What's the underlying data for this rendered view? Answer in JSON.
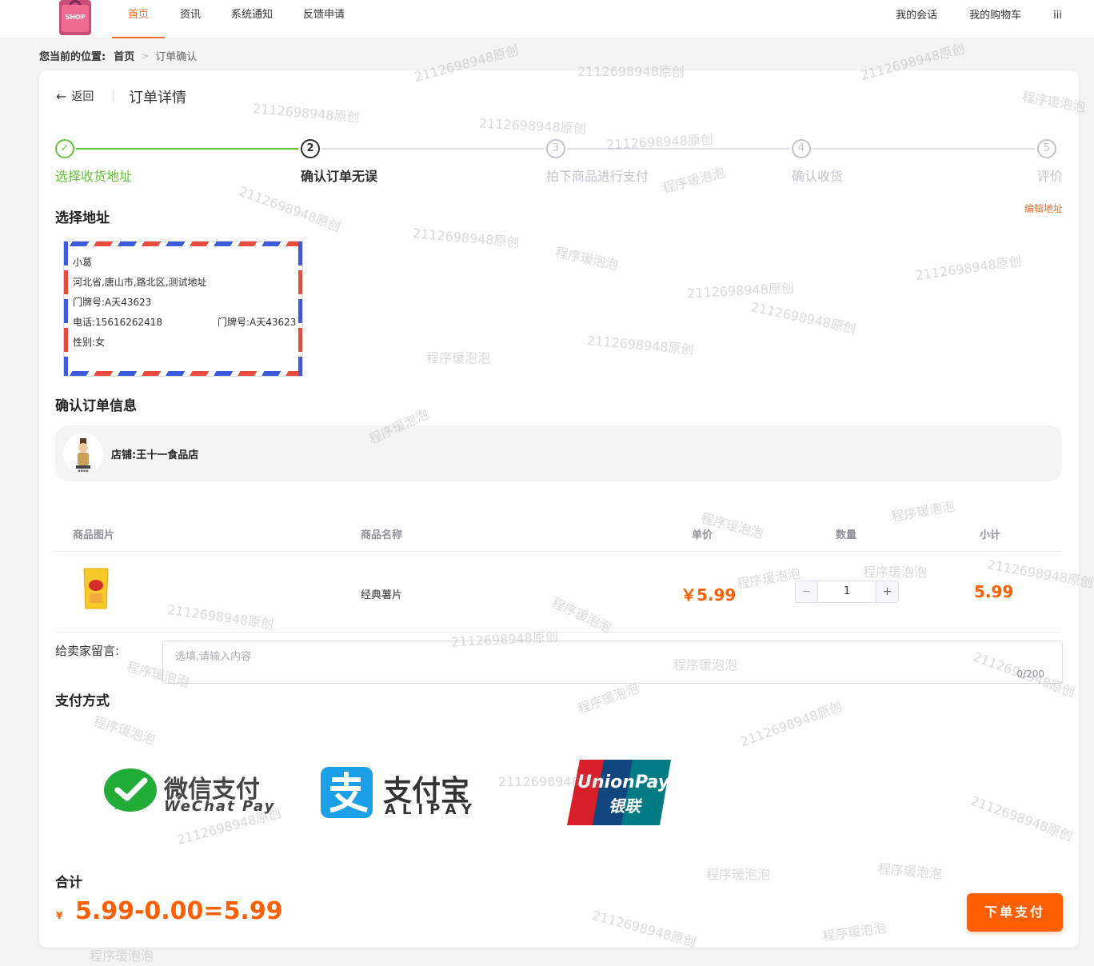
{
  "header": {
    "logo_text": "SHOP",
    "nav": [
      "首页",
      "资讯",
      "系统通知",
      "反馈申请"
    ],
    "right_nav": [
      "我的会话",
      "我的购物车",
      "iii"
    ]
  },
  "breadcrumb": {
    "prefix": "您当前的位置:",
    "home": "首页",
    "separator": ">",
    "current": "订单确认"
  },
  "page": {
    "back_label": "返回",
    "title": "订单详情"
  },
  "steps": [
    {
      "index": "1",
      "label": "选择收货地址",
      "status": "done"
    },
    {
      "index": "2",
      "label": "确认订单无误",
      "status": "current"
    },
    {
      "index": "3",
      "label": "拍下商品进行支付",
      "status": "wait"
    },
    {
      "index": "4",
      "label": "确认收货",
      "status": "wait"
    },
    {
      "index": "5",
      "label": "评价",
      "status": "wait"
    }
  ],
  "address": {
    "section_title": "选择地址",
    "edit_label": "编辑地址",
    "name": "小葛",
    "region": "河北省,唐山市,路北区,测试地址",
    "door": "门牌号:A天43623",
    "phone": "电话:15616262418",
    "door2": "门牌号:A天43623",
    "gender": "性别:女"
  },
  "order": {
    "section_title": "确认订单信息",
    "shop_name": "店铺:王十一食品店",
    "columns": [
      "商品图片",
      "商品名称",
      "单价",
      "数量",
      "小计"
    ],
    "item": {
      "name": "经典薯片",
      "price": "￥5.99",
      "quantity": "1",
      "subtotal": "5.99"
    },
    "stepper_minus": "−",
    "stepper_plus": "+"
  },
  "message": {
    "label": "给卖家留言:",
    "placeholder": "选填,请输入内容",
    "counter": "0/200"
  },
  "payment": {
    "section_title": "支付方式",
    "wechat_cn": "微信支付",
    "wechat_en": "WeChat Pay",
    "alipay_cn": "支付宝",
    "alipay_en": "ALIPAY",
    "union_en": "UnionPay",
    "union_cn": "银联"
  },
  "total": {
    "label": "合计",
    "currency": "¥",
    "expression": "5.99-0.00=5.99"
  },
  "submit_label": "下单支付",
  "watermarks": [
    "2112698948原创",
    "程序瑗泡泡"
  ],
  "colors": {
    "accent": "#ff5f00",
    "nav_active": "#f0702f",
    "step_done": "#67c23a"
  }
}
